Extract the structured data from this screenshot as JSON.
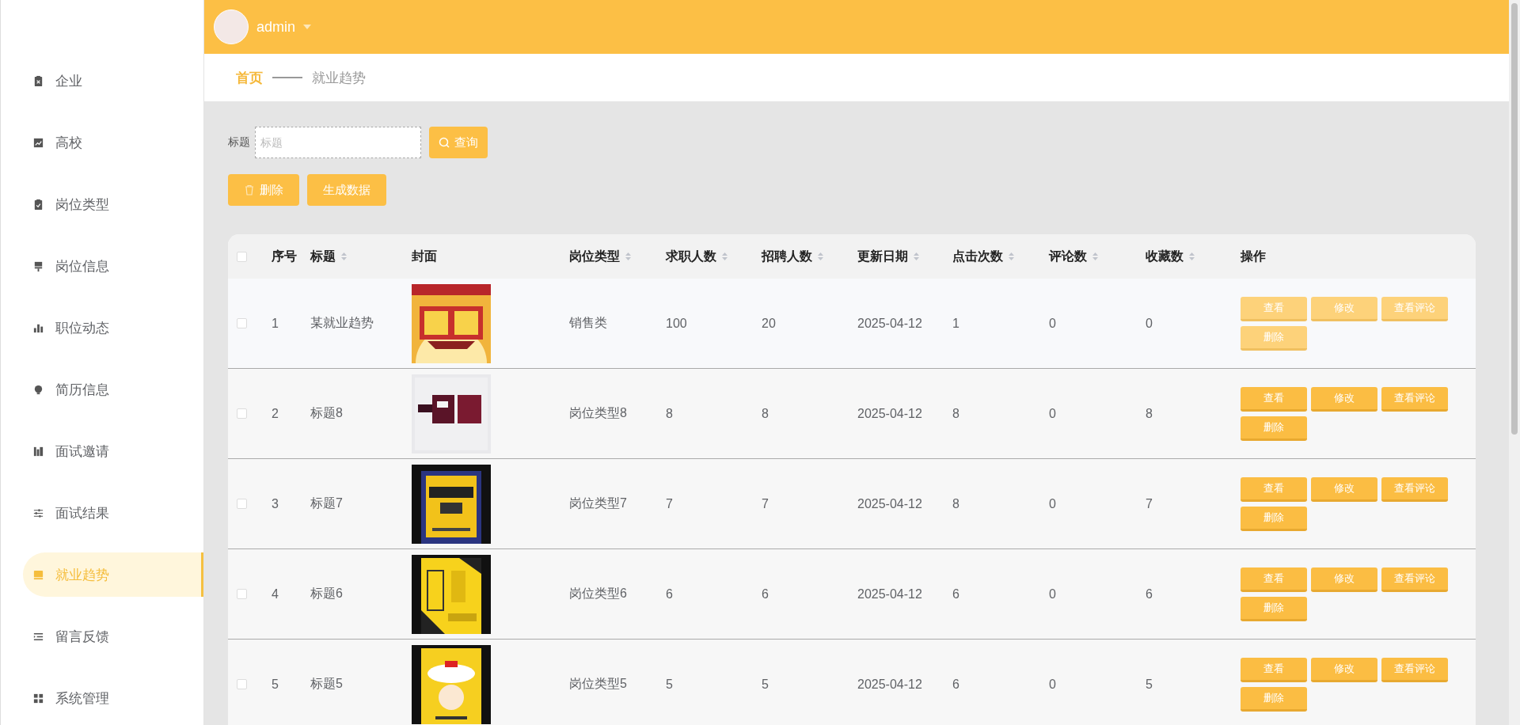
{
  "header": {
    "user": "admin"
  },
  "sidebar": {
    "items": [
      {
        "label": "企业",
        "selected": false
      },
      {
        "label": "高校",
        "selected": false
      },
      {
        "label": "岗位类型",
        "selected": false
      },
      {
        "label": "岗位信息",
        "selected": false
      },
      {
        "label": "职位动态",
        "selected": false
      },
      {
        "label": "简历信息",
        "selected": false
      },
      {
        "label": "面试邀请",
        "selected": false
      },
      {
        "label": "面试结果",
        "selected": false
      },
      {
        "label": "就业趋势",
        "selected": true
      },
      {
        "label": "留言反馈",
        "selected": false
      },
      {
        "label": "系统管理",
        "selected": false
      }
    ]
  },
  "breadcrumb": [
    "首页",
    "就业趋势"
  ],
  "search": {
    "label": "标题",
    "placeholder": "标题",
    "button": "查询"
  },
  "toolbar": [
    "删除",
    "生成数据"
  ],
  "table": {
    "select_all": {
      "checked": false
    },
    "columns": [
      {
        "label": "序号",
        "sortable": false
      },
      {
        "label": "标题",
        "sortable": true
      },
      {
        "label": "封面",
        "sortable": false
      },
      {
        "label": "岗位类型",
        "sortable": true
      },
      {
        "label": "求职人数",
        "sortable": true
      },
      {
        "label": "招聘人数",
        "sortable": true
      },
      {
        "label": "更新日期",
        "sortable": true
      },
      {
        "label": "点击次数",
        "sortable": true
      },
      {
        "label": "评论数",
        "sortable": true
      },
      {
        "label": "收藏数",
        "sortable": true
      },
      {
        "label": "操作",
        "sortable": false
      }
    ],
    "rows": [
      {
        "checked": false,
        "hovered": true,
        "cells": [
          "1",
          "某就业趋势",
          {
            "kind": "picture"
          },
          "销售类",
          "100",
          "20",
          "2025-04-12",
          "1",
          "0",
          "0"
        ],
        "actions": [
          "查看",
          "修改",
          "查看评论",
          "删除"
        ]
      },
      {
        "checked": false,
        "hovered": false,
        "cells": [
          "2",
          "标题8",
          {
            "kind": "picture"
          },
          "岗位类型8",
          "8",
          "8",
          "2025-04-12",
          "8",
          "0",
          "8"
        ],
        "actions": [
          "查看",
          "修改",
          "查看评论",
          "删除"
        ]
      },
      {
        "checked": false,
        "hovered": false,
        "cells": [
          "3",
          "标题7",
          {
            "kind": "picture"
          },
          "岗位类型7",
          "7",
          "7",
          "2025-04-12",
          "8",
          "0",
          "7"
        ],
        "actions": [
          "查看",
          "修改",
          "查看评论",
          "删除"
        ]
      },
      {
        "checked": false,
        "hovered": false,
        "cells": [
          "4",
          "标题6",
          {
            "kind": "picture"
          },
          "岗位类型6",
          "6",
          "6",
          "2025-04-12",
          "6",
          "0",
          "6"
        ],
        "actions": [
          "查看",
          "修改",
          "查看评论",
          "删除"
        ]
      },
      {
        "checked": false,
        "hovered": false,
        "cells": [
          "5",
          "标题5",
          {
            "kind": "picture"
          },
          "岗位类型5",
          "5",
          "5",
          "2025-04-12",
          "6",
          "0",
          "5"
        ],
        "actions": [
          "查看",
          "修改",
          "查看评论",
          "删除"
        ]
      }
    ]
  }
}
